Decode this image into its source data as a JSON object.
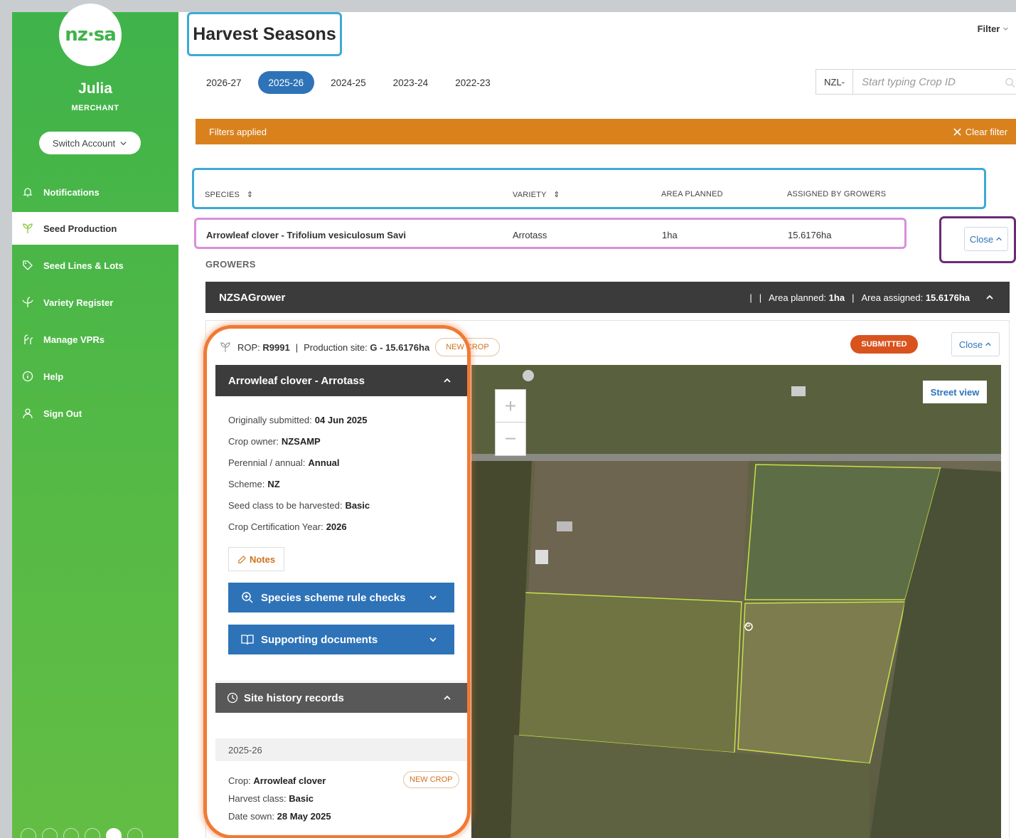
{
  "sidebar": {
    "logo_text": "nz·sa",
    "user_name": "Julia",
    "user_role": "MERCHANT",
    "switch_account": "Switch Account",
    "items": [
      {
        "label": "Notifications",
        "icon": "bell-icon"
      },
      {
        "label": "Seed Production",
        "icon": "seedling-icon"
      },
      {
        "label": "Seed Lines & Lots",
        "icon": "tag-icon"
      },
      {
        "label": "Variety Register",
        "icon": "plant-icon"
      },
      {
        "label": "Manage VPRs",
        "icon": "sprout-icon"
      },
      {
        "label": "Help",
        "icon": "info-icon"
      },
      {
        "label": "Sign Out",
        "icon": "user-icon"
      }
    ]
  },
  "header": {
    "title": "Harvest Seasons",
    "filter_label": "Filter"
  },
  "season_tabs": [
    "2026-27",
    "2025-26",
    "2024-25",
    "2023-24",
    "2022-23"
  ],
  "active_tab": "2025-26",
  "crop_search": {
    "prefix": "NZL-",
    "placeholder": "Start typing Crop ID"
  },
  "filter_bar": {
    "text": "Filters applied",
    "clear": "Clear filter"
  },
  "table": {
    "headers": [
      "SPECIES",
      "VARIETY",
      "AREA PLANNED",
      "ASSIGNED BY GROWERS"
    ],
    "row": {
      "species": "Arrowleaf clover - Trifolium vesiculosum Savi",
      "variety": "Arrotass",
      "area_planned": "1ha",
      "assigned": "15.6176ha"
    },
    "close_label": "Close"
  },
  "growers": {
    "label": "GROWERS",
    "grower_name": "NZSAGrower",
    "sep": "|",
    "area_planned_label": "Area planned:",
    "area_planned_value": "1ha",
    "area_assigned_label": "Area assigned:",
    "area_assigned_value": "15.6176ha"
  },
  "detail": {
    "rop_label": "ROP:",
    "rop_value": "R9991",
    "site_label": "Production site:",
    "site_value": "G - 15.6176ha",
    "new_crop": "NEW CROP",
    "status": "SUBMITTED",
    "close_label": "Close",
    "panel_title": "Arrowleaf clover - Arrotass",
    "fields": [
      {
        "label": "Originally submitted:",
        "value": "04 Jun 2025"
      },
      {
        "label": "Crop owner:",
        "value": "NZSAMP"
      },
      {
        "label": "Perennial / annual:",
        "value": "Annual"
      },
      {
        "label": "Scheme:",
        "value": "NZ"
      },
      {
        "label": "Seed class to be harvested:",
        "value": "Basic"
      },
      {
        "label": "Crop Certification Year:",
        "value": "2026"
      }
    ],
    "notes_label": "Notes",
    "species_checks": "Species scheme rule checks",
    "supporting_docs": "Supporting documents",
    "site_history": "Site history records",
    "history": {
      "season": "2025-26",
      "crop_label": "Crop:",
      "crop_value": "Arrowleaf clover",
      "class_label": "Harvest class:",
      "class_value": "Basic",
      "sown_label": "Date sown:",
      "sown_value": "28 May 2025",
      "badge": "NEW CROP"
    }
  },
  "map": {
    "zoom_in": "+",
    "zoom_out": "−",
    "street_view": "Street view",
    "marker": "G"
  },
  "colors": {
    "sidebar_green": "#3fb34a",
    "primary_blue": "#2e73b8",
    "filter_orange": "#d9821d",
    "submitted": "#d9531e",
    "dark_bar": "#3b3b3b"
  }
}
